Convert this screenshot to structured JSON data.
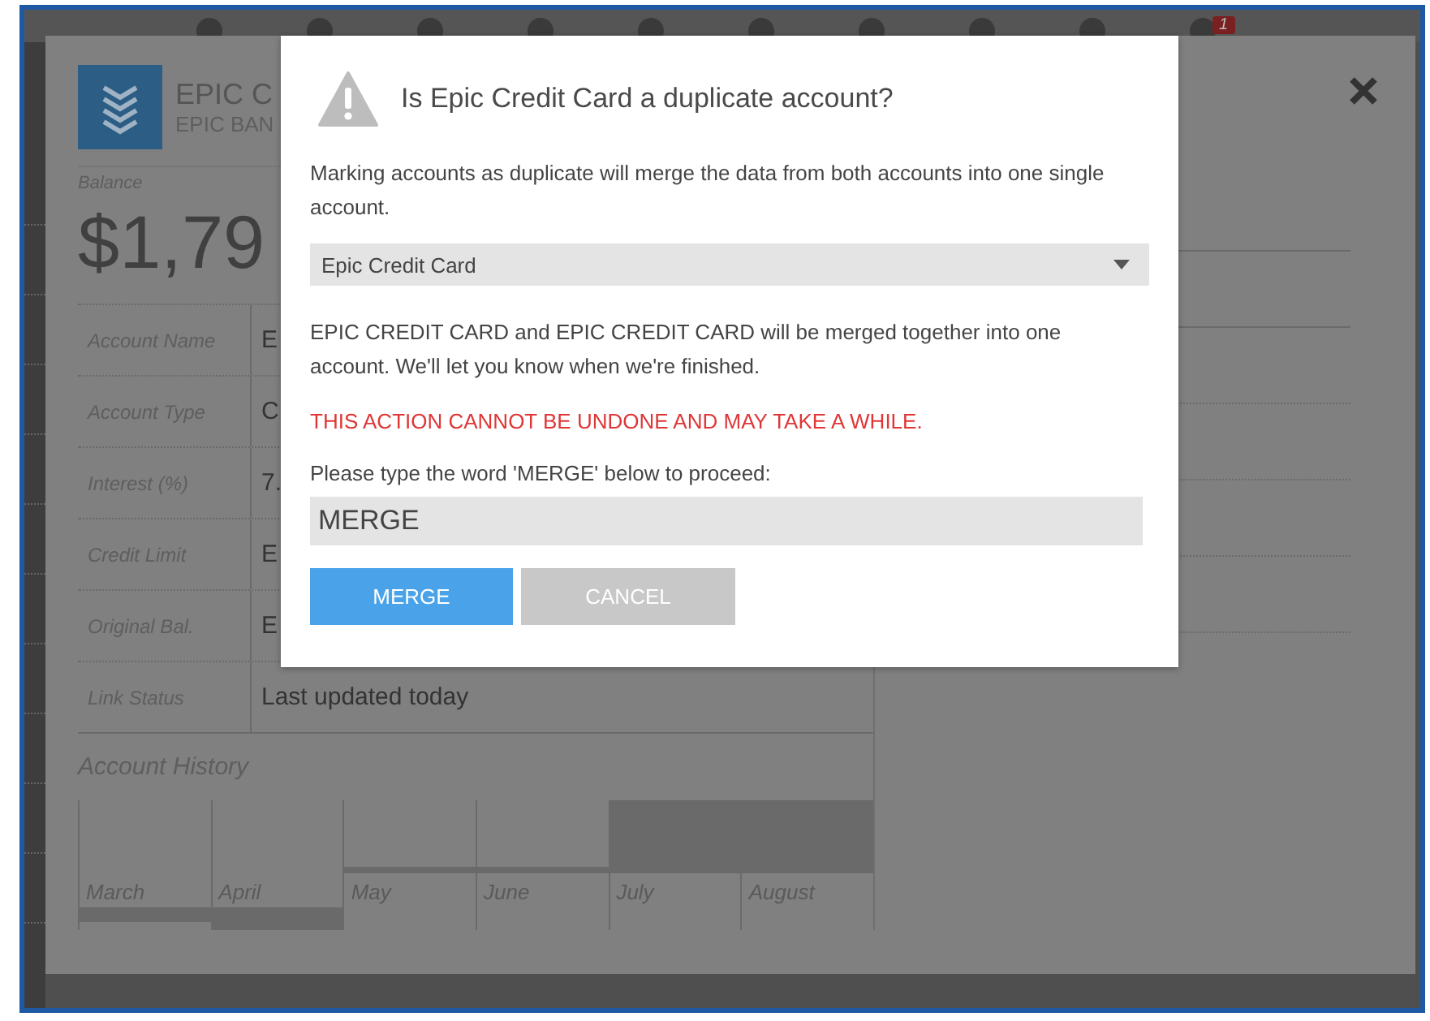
{
  "toolbar": {
    "badge": "1"
  },
  "account_panel": {
    "title": "EPIC C",
    "subtitle": "EPIC BAN",
    "balance_label": "Balance",
    "balance": "$1,79",
    "fields": [
      {
        "label": "Account Name",
        "value": "E"
      },
      {
        "label": "Account Type",
        "value": "C"
      },
      {
        "label": "Interest (%)",
        "value": "7."
      },
      {
        "label": "Credit Limit",
        "value": "E"
      },
      {
        "label": "Original Bal.",
        "value": "E"
      },
      {
        "label": "Link Status",
        "value": "Last updated today"
      }
    ],
    "history": {
      "title": "Account History",
      "months": [
        "March",
        "April",
        "May",
        "June",
        "July",
        "August"
      ]
    }
  },
  "dialog": {
    "title": "Is Epic Credit Card a duplicate account?",
    "message": "Marking accounts as duplicate will merge the data from both accounts into one single account.",
    "select": {
      "value": "Epic Credit Card"
    },
    "notice": "EPIC CREDIT CARD and EPIC CREDIT CARD will be merged together into one account. We'll let you know when we're finished.",
    "warning": "THIS ACTION CANNOT BE UNDONE AND MAY TAKE A WHILE.",
    "prompt": "Please type the word 'MERGE' below to proceed:",
    "input": {
      "value": "MERGE"
    },
    "buttons": [
      {
        "label": "MERGE",
        "kind": "primary"
      },
      {
        "label": "CANCEL",
        "kind": "secondary"
      }
    ]
  }
}
